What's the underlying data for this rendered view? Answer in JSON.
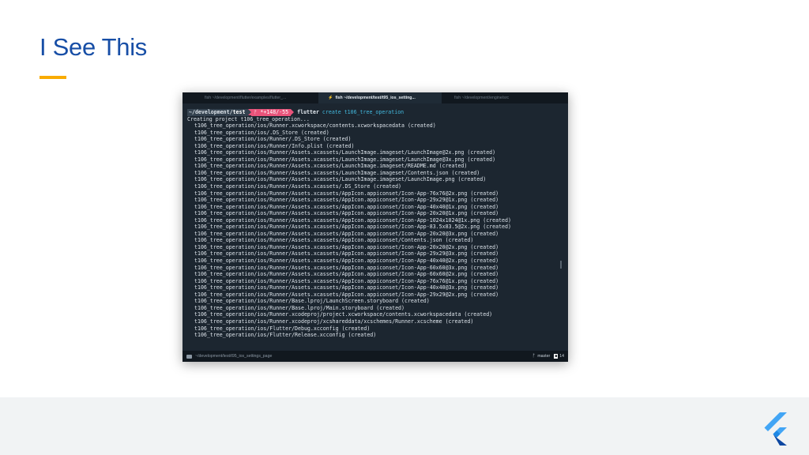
{
  "slide": {
    "title": "I See This"
  },
  "terminal": {
    "tabs": [
      {
        "label": "fish ~/development/flutter/examples/flutter_..."
      },
      {
        "label": "fish ~/development/test/t95_ios_setting..."
      },
      {
        "label": "fish ~/development/engine/src"
      }
    ],
    "prompt": {
      "path_prefix": "~/development/",
      "path_highlight": "test",
      "git_status": "ᚠ *+148/-55",
      "command": "flutter",
      "args": "create t106_tree_operation"
    },
    "output": {
      "creating": "Creating project t106_tree_operation...",
      "files": [
        "t106_tree_operation/ios/Runner.xcworkspace/contents.xcworkspacedata (created)",
        "t106_tree_operation/ios/.DS_Store (created)",
        "t106_tree_operation/ios/Runner/.DS_Store (created)",
        "t106_tree_operation/ios/Runner/Info.plist (created)",
        "t106_tree_operation/ios/Runner/Assets.xcassets/LaunchImage.imageset/LaunchImage@2x.png (created)",
        "t106_tree_operation/ios/Runner/Assets.xcassets/LaunchImage.imageset/LaunchImage@3x.png (created)",
        "t106_tree_operation/ios/Runner/Assets.xcassets/LaunchImage.imageset/README.md (created)",
        "t106_tree_operation/ios/Runner/Assets.xcassets/LaunchImage.imageset/Contents.json (created)",
        "t106_tree_operation/ios/Runner/Assets.xcassets/LaunchImage.imageset/LaunchImage.png (created)",
        "t106_tree_operation/ios/Runner/Assets.xcassets/.DS_Store (created)",
        "t106_tree_operation/ios/Runner/Assets.xcassets/AppIcon.appiconset/Icon-App-76x76@2x.png (created)",
        "t106_tree_operation/ios/Runner/Assets.xcassets/AppIcon.appiconset/Icon-App-29x29@1x.png (created)",
        "t106_tree_operation/ios/Runner/Assets.xcassets/AppIcon.appiconset/Icon-App-40x40@1x.png (created)",
        "t106_tree_operation/ios/Runner/Assets.xcassets/AppIcon.appiconset/Icon-App-20x20@1x.png (created)",
        "t106_tree_operation/ios/Runner/Assets.xcassets/AppIcon.appiconset/Icon-App-1024x1024@1x.png (created)",
        "t106_tree_operation/ios/Runner/Assets.xcassets/AppIcon.appiconset/Icon-App-83.5x83.5@2x.png (created)",
        "t106_tree_operation/ios/Runner/Assets.xcassets/AppIcon.appiconset/Icon-App-20x20@3x.png (created)",
        "t106_tree_operation/ios/Runner/Assets.xcassets/AppIcon.appiconset/Contents.json (created)",
        "t106_tree_operation/ios/Runner/Assets.xcassets/AppIcon.appiconset/Icon-App-20x20@2x.png (created)",
        "t106_tree_operation/ios/Runner/Assets.xcassets/AppIcon.appiconset/Icon-App-29x29@3x.png (created)",
        "t106_tree_operation/ios/Runner/Assets.xcassets/AppIcon.appiconset/Icon-App-40x40@2x.png (created)",
        "t106_tree_operation/ios/Runner/Assets.xcassets/AppIcon.appiconset/Icon-App-60x60@3x.png (created)",
        "t106_tree_operation/ios/Runner/Assets.xcassets/AppIcon.appiconset/Icon-App-60x60@2x.png (created)",
        "t106_tree_operation/ios/Runner/Assets.xcassets/AppIcon.appiconset/Icon-App-76x76@1x.png (created)",
        "t106_tree_operation/ios/Runner/Assets.xcassets/AppIcon.appiconset/Icon-App-40x40@3x.png (created)",
        "t106_tree_operation/ios/Runner/Assets.xcassets/AppIcon.appiconset/Icon-App-29x29@2x.png (created)",
        "t106_tree_operation/ios/Runner/Base.lproj/LaunchScreen.storyboard (created)",
        "t106_tree_operation/ios/Runner/Base.lproj/Main.storyboard (created)",
        "t106_tree_operation/ios/Runner.xcodeproj/project.xcworkspace/contents.xcworkspacedata (created)",
        "t106_tree_operation/ios/Runner.xcodeproj/xcshareddata/xcschemes/Runner.xcscheme (created)",
        "t106_tree_operation/ios/Flutter/Debug.xcconfig (created)",
        "t106_tree_operation/ios/Flutter/Release.xcconfig (created)"
      ]
    },
    "status_bar": {
      "path": "~/development/test/t95_ios_settings_page",
      "branch": "master",
      "count": "14"
    }
  },
  "colors": {
    "title": "#174ea6",
    "accent": "#f9ab00",
    "terminal_bg": "#1c2630",
    "git_segment": "#e8537a",
    "command_args": "#42b8dd"
  },
  "icons": [
    "bolt-icon",
    "folder-icon",
    "branch-icon",
    "flutter-logo-icon"
  ]
}
